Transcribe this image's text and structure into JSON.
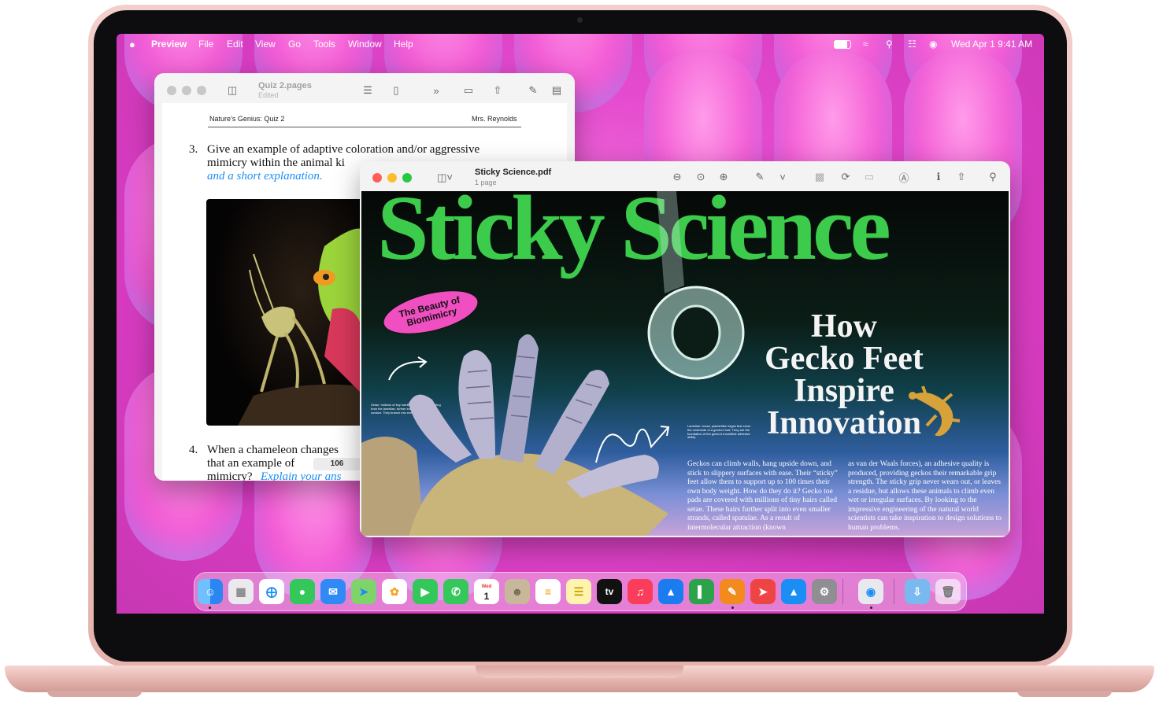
{
  "menubar": {
    "apple": "",
    "app": "Preview",
    "items": [
      "File",
      "Edit",
      "View",
      "Go",
      "Tools",
      "Window",
      "Help"
    ],
    "date_time": "Wed Apr 1  9:41 AM"
  },
  "pages_window": {
    "title": "Quiz 2.pages",
    "subtitle": "Edited",
    "header_left": "Nature’s Genius: Quiz 2",
    "header_right": "Mrs. Reynolds",
    "q3_number": "3.",
    "q3_line1": "Give an example of adaptive coloration and/or aggressive",
    "q3_line2": "mimicry within the animal ki",
    "q3_answer_tail": "",
    "q3_answer": "and a short explanation.",
    "q4_number": "4.",
    "q4_line1": "When a chameleon changes",
    "q4_line2": "that an example of",
    "q4_line3": "mimicry?",
    "q4_answer": "Explain your ans",
    "word_count": "106"
  },
  "preview_window": {
    "title": "Sticky Science.pdf",
    "subtitle": "1 page",
    "headline": "Sticky Science",
    "badge": "The Beauty of Biomimicry",
    "subhead": [
      "How",
      "Gecko Feet",
      "Inspire",
      "Innovation"
    ],
    "caption_setae": "Setae: millions of tiny hairlike structures extending from the lamellae, further increasing surface contact. They branch into even finer “hairs.”",
    "caption_lamellae": "Lamellae: broad, plateletlike ridges that cover the underside of a gecko’s foot. They are the foundation of the gecko’s incredible adhesive ability.",
    "body_col1": "Geckos can climb walls, hang upside down, and stick to slippery surfaces with ease. Their “sticky” feet allow them to support up to 100 times their own body weight. How do they do it? Gecko toe pads are covered with millions of tiny hairs called setae. These hairs further split into even smaller strands, called spatulae. As a result of intermolecular attraction (known",
    "body_col2": "as van der Waals forces), an adhesive quality is produced, providing geckos their remarkable grip strength. The sticky grip never wears out, or leaves a residue, but allows these animals to climb even wet or irregular surfaces. By looking to the impressive engineering of the natural world scientists can take inspiration to design solutions to human problems."
  },
  "dock": {
    "calendar_month": "Wed",
    "calendar_day": "1",
    "tv_label": "tv",
    "apps": [
      "Finder",
      "Launchpad",
      "Safari",
      "Messages",
      "Mail",
      "Maps",
      "Photos",
      "FaceTime",
      "Phone",
      "Calendar",
      "Contacts",
      "Reminders",
      "Notes",
      "TV",
      "Music",
      "Keynote",
      "Numbers",
      "Pages",
      "Rocket",
      "App Store",
      "System Settings",
      "Preview",
      "Downloads",
      "Trash"
    ]
  },
  "colors": {
    "headline_green": "#3ccb4a",
    "badge_pink": "#ef4fc1",
    "link_blue": "#1a8ef5",
    "wallpaper": "#e54bcf"
  }
}
